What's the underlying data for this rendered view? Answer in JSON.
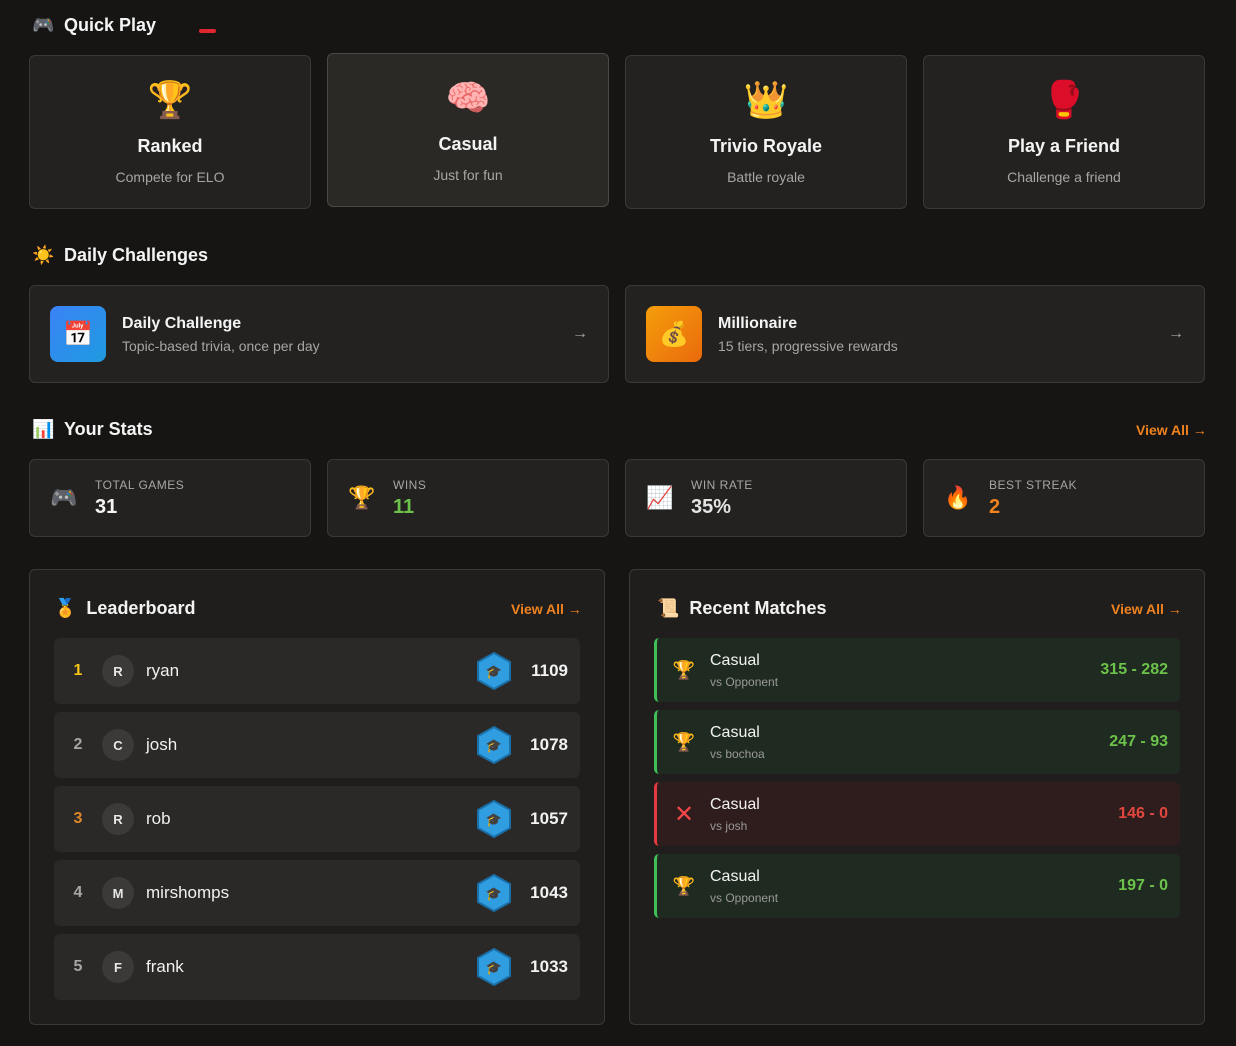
{
  "quick_play": {
    "title": "Quick Play",
    "cards": [
      {
        "emoji": "🏆",
        "title": "Ranked",
        "sub": "Compete for ELO"
      },
      {
        "emoji": "🧠",
        "title": "Casual",
        "sub": "Just for fun"
      },
      {
        "emoji": "👑",
        "title": "Trivio Royale",
        "sub": "Battle royale"
      },
      {
        "emoji": "🥊",
        "title": "Play a Friend",
        "sub": "Challenge a friend"
      }
    ]
  },
  "daily": {
    "title": "Daily Challenges",
    "cards": [
      {
        "icon": "📅",
        "title": "Daily Challenge",
        "sub": "Topic-based trivia, once per day",
        "arrow": "→"
      },
      {
        "icon": "💰",
        "title": "Millionaire",
        "sub": "15 tiers, progressive rewards",
        "arrow": "→"
      }
    ]
  },
  "stats": {
    "title": "Your Stats",
    "view_all": "View All →",
    "items": [
      {
        "icon": "🎮",
        "label": "TOTAL GAMES",
        "value": "31",
        "color": "#f4f4f4"
      },
      {
        "icon": "🏆",
        "label": "WINS",
        "value": "11",
        "color": "#6cc24a"
      },
      {
        "icon": "📈",
        "label": "WIN RATE",
        "value": "35%",
        "color": "#e4e4e4"
      },
      {
        "icon": "🔥",
        "label": "BEST STREAK",
        "value": "2",
        "color": "#f0821f"
      }
    ]
  },
  "leaderboard": {
    "title": "Leaderboard",
    "view_all": "View All →",
    "rows": [
      {
        "rank": "1",
        "initial": "R",
        "name": "ryan",
        "elo": "1109",
        "rank_color": "#f5c518"
      },
      {
        "rank": "2",
        "initial": "C",
        "name": "josh",
        "elo": "1078",
        "rank_color": "#a7a6a3"
      },
      {
        "rank": "3",
        "initial": "R",
        "name": "rob",
        "elo": "1057",
        "rank_color": "#e0862a"
      },
      {
        "rank": "4",
        "initial": "M",
        "name": "mirshomps",
        "elo": "1043",
        "rank_color": "#a7a6a3"
      },
      {
        "rank": "5",
        "initial": "F",
        "name": "frank",
        "elo": "1033",
        "rank_color": "#a7a6a3"
      }
    ]
  },
  "recent": {
    "title": "Recent Matches",
    "view_all": "View All →",
    "rows": [
      {
        "result": "win",
        "icon": "🏆",
        "mode": "Casual",
        "opponent": "vs Opponent",
        "score": "315 - 282"
      },
      {
        "result": "win",
        "icon": "🏆",
        "mode": "Casual",
        "opponent": "vs bochoa",
        "score": "247 - 93"
      },
      {
        "result": "loss",
        "icon": "✕",
        "mode": "Casual",
        "opponent": "vs josh",
        "score": "146 - 0"
      },
      {
        "result": "win",
        "icon": "🏆",
        "mode": "Casual",
        "opponent": "vs Opponent",
        "score": "197 - 0"
      }
    ]
  }
}
